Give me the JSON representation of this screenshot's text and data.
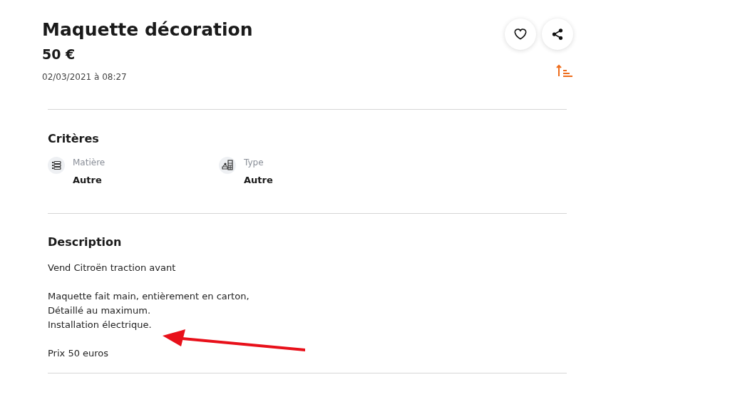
{
  "listing": {
    "title": "Maquette décoration",
    "price": "50 €",
    "date": "02/03/2021 à 08:27"
  },
  "criteria": {
    "heading": "Critères",
    "items": [
      {
        "kind": "material",
        "label": "Matière",
        "value": "Autre"
      },
      {
        "kind": "type",
        "label": "Type",
        "value": "Autre"
      }
    ]
  },
  "description": {
    "heading": "Description",
    "paragraphs": [
      [
        "Vend Citroën traction avant"
      ],
      [
        "Maquette fait main, entièrement en carton,",
        "Détaillé au maximum.",
        "Installation électrique."
      ],
      [
        "Prix 50 euros"
      ]
    ]
  }
}
